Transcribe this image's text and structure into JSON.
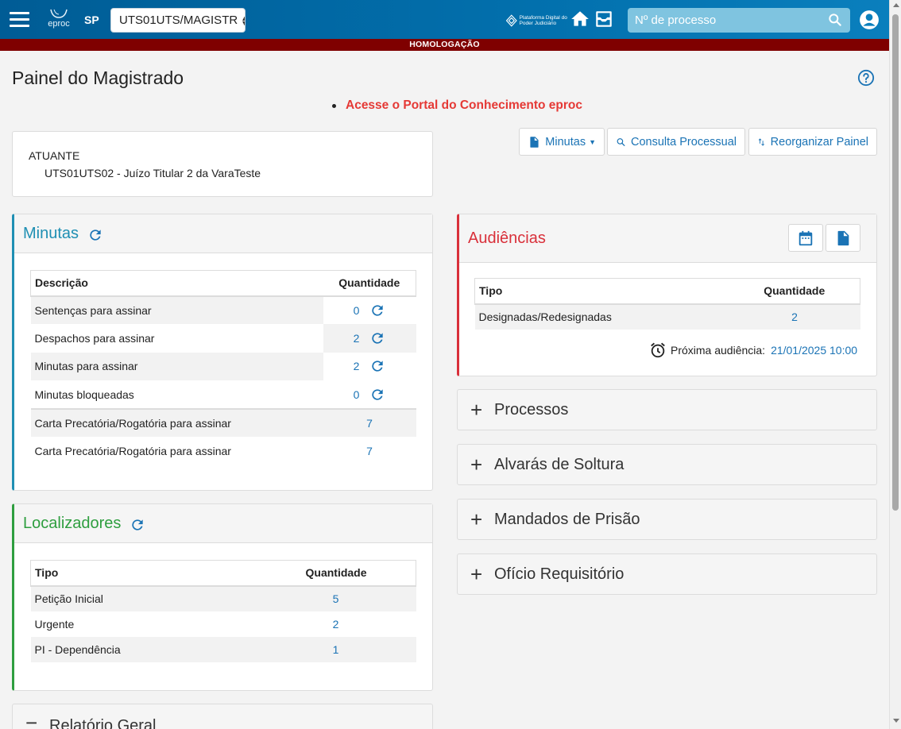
{
  "header": {
    "logo_text": "eproc",
    "state": "SP",
    "org_select_value": "UTS01UTS/MAGISTR",
    "pdpj_text": "Plataforma Digital do Poder Judiciário",
    "search_placeholder": "Nº de processo",
    "colors": {
      "bar": "#0270ad",
      "search_bg": "#7fc4e0"
    }
  },
  "environment_banner": "HOMOLOGAÇÃO",
  "page_title": "Painel do Magistrado",
  "portal_link": "Acesse o Portal do Conhecimento eproc",
  "toolbar": {
    "minutas_label": "Minutas",
    "consulta_label": "Consulta Processual",
    "reorganizar_label": "Reorganizar Painel"
  },
  "atuante": {
    "label": "ATUANTE",
    "value": "UTS01UTS02 - Juízo Titular 2 da VaraTeste"
  },
  "minutas": {
    "title": "Minutas",
    "accent": "#1f8fb3",
    "headers": [
      "Descrição",
      "Quantidade"
    ],
    "rows": [
      {
        "descricao": "Sentenças para assinar",
        "quantidade": "0",
        "refresh": true
      },
      {
        "descricao": "Despachos para assinar",
        "quantidade": "2",
        "refresh": true
      },
      {
        "descricao": "Minutas para assinar",
        "quantidade": "2",
        "refresh": true
      },
      {
        "descricao": "Minutas bloqueadas",
        "quantidade": "0",
        "refresh": true
      },
      {
        "descricao": "Carta Precatória/Rogatória para assinar",
        "quantidade": "7",
        "refresh": false
      },
      {
        "descricao": "Carta Precatória/Rogatória para assinar",
        "quantidade": "7",
        "refresh": false
      }
    ]
  },
  "localizadores": {
    "title": "Localizadores",
    "accent": "#2e9e3f",
    "headers": [
      "Tipo",
      "Quantidade"
    ],
    "rows": [
      {
        "tipo": "Petição Inicial",
        "quantidade": "5"
      },
      {
        "tipo": "Urgente",
        "quantidade": "2"
      },
      {
        "tipo": "PI - Dependência",
        "quantidade": "1"
      }
    ]
  },
  "relatorio": {
    "title": "Relatório Geral"
  },
  "audiencias": {
    "title": "Audiências",
    "accent": "#d9303a",
    "headers": [
      "Tipo",
      "Quantidade"
    ],
    "rows": [
      {
        "tipo": "Designadas/Redesignadas",
        "quantidade": "2"
      }
    ],
    "proxima_label": "Próxima audiência:",
    "proxima_value": "21/01/2025 10:00"
  },
  "collapsed_panels": [
    "Processos",
    "Alvarás de Soltura",
    "Mandados de Prisão",
    "Ofício Requisitório"
  ]
}
